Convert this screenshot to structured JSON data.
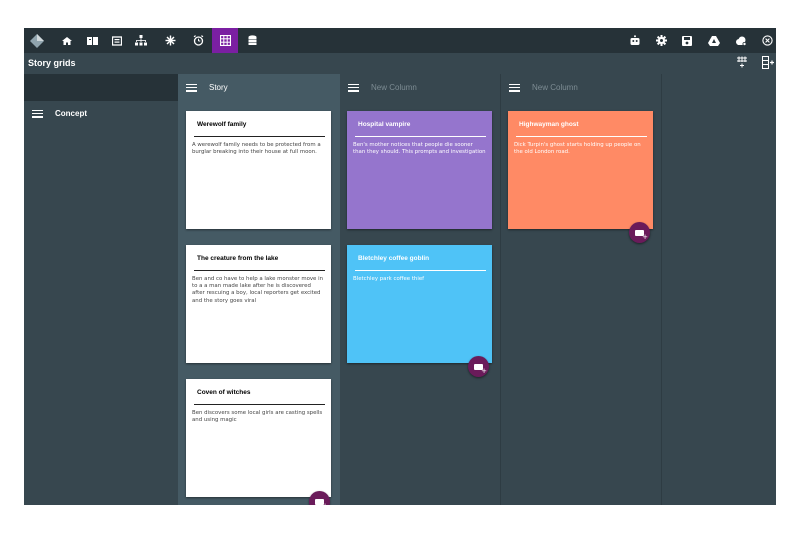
{
  "toolbar": {
    "left_icons": [
      "logo-diamond-icon",
      "home-icon",
      "book-icon",
      "card-icon",
      "hierarchy-icon",
      "asterisk-icon",
      "alarm-icon",
      "grid-icon",
      "database-icon"
    ],
    "right_icons": [
      "robot-icon",
      "gear-icon",
      "save-icon",
      "drive-icon",
      "cloud-sync-icon",
      "close-circle-icon"
    ],
    "active_icon": "grid-icon"
  },
  "page": {
    "title": "Story grids",
    "actions": [
      "add-column-icon",
      "add-row-icon"
    ]
  },
  "sidebar": {
    "label": "Concept"
  },
  "columns": [
    {
      "title": "Story",
      "faded": false,
      "cards": [
        {
          "title": "Werewolf family",
          "body": "A werewolf family needs to be protected from a burglar breaking into their house at full moon."
        },
        {
          "title": "The creature from the lake",
          "body": "Ben and co have to help a lake monster move in to a a man made lake after he is discovered after rescuing a boy, local reporters get excited and the story goes viral"
        },
        {
          "title": "Coven of witches",
          "body": "Ben discovers some local girls are casting spells and using magic"
        }
      ]
    },
    {
      "title": "New Column",
      "faded": true,
      "cards": [
        {
          "title": "Hospital vampire",
          "body": "Ben's mother notices that people die sooner than they should. This prompts and investigation"
        },
        {
          "title": "Bletchley coffee goblin",
          "body": "Bletchley park coffee thief"
        }
      ]
    },
    {
      "title": "New Column",
      "faded": true,
      "cards": [
        {
          "title": "Highwayman ghost",
          "body": "Dick Turpin's ghost starts holding up people on the old London road."
        }
      ]
    }
  ],
  "colors": {
    "topbar": "#263238",
    "board": "#37474f",
    "active_tab": "#7b1fa2",
    "fab": "#6a1b5a",
    "card_white": "#ffffff",
    "card_purple": "#9575cd",
    "card_blue": "#4fc3f7",
    "card_orange": "#ff8a65"
  }
}
